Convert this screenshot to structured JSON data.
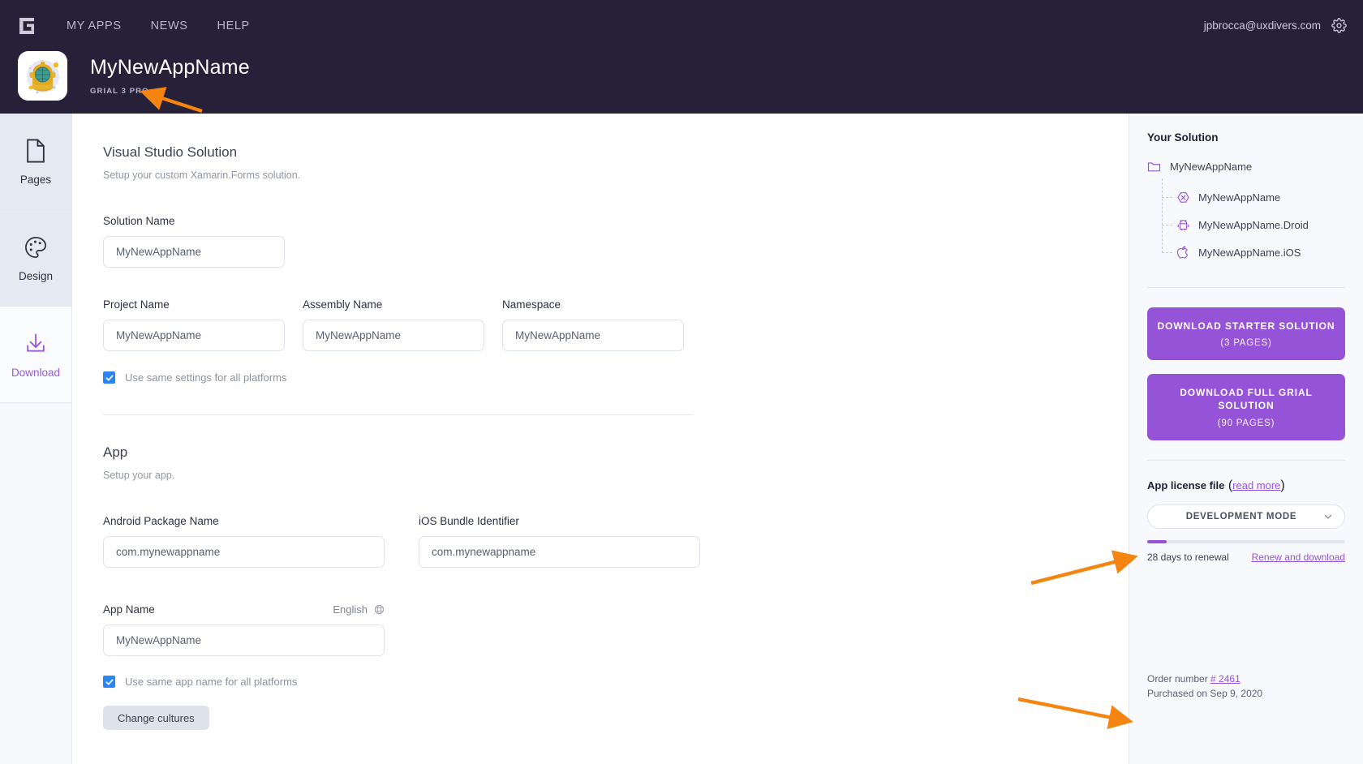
{
  "header": {
    "logo_icon": "grial-logo-icon",
    "nav": [
      {
        "label": "MY APPS"
      },
      {
        "label": "NEWS"
      },
      {
        "label": "HELP"
      }
    ],
    "user_email": "jpbrocca@uxdivers.com",
    "settings_icon": "gear-icon",
    "app_title": "MyNewAppName",
    "app_subtitle": "GRIAL 3 PRO",
    "app_icon": "diving-helmet-icon",
    "background_color": "#262138"
  },
  "sidebar": {
    "items": [
      {
        "label": "Pages",
        "icon": "document-icon",
        "active": false
      },
      {
        "label": "Design",
        "icon": "palette-icon",
        "active": false
      },
      {
        "label": "Download",
        "icon": "download-icon",
        "active": true
      }
    ],
    "active_color": "#9b59e0"
  },
  "main": {
    "solution_section": {
      "title": "Visual Studio Solution",
      "subtitle": "Setup your custom Xamarin.Forms solution.",
      "fields": [
        {
          "label": "Solution Name",
          "value": "MyNewAppName"
        },
        {
          "label": "Project Name",
          "value": "MyNewAppName"
        },
        {
          "label": "Assembly Name",
          "value": "MyNewAppName"
        },
        {
          "label": "Namespace",
          "value": "MyNewAppName"
        }
      ],
      "checkbox": {
        "label": "Use same settings for all platforms",
        "checked": true
      }
    },
    "app_section": {
      "title": "App",
      "subtitle": "Setup your app.",
      "fields": [
        {
          "label": "Android Package Name",
          "value": "com.mynewappname"
        },
        {
          "label": "iOS Bundle Identifier",
          "value": "com.mynewappname"
        }
      ],
      "app_name": {
        "label": "App Name",
        "language": "English",
        "language_icon": "globe-icon",
        "value": "MyNewAppName"
      },
      "checkbox": {
        "label": "Use same app name for all platforms",
        "checked": true
      },
      "cultures_button": "Change cultures"
    },
    "checkbox_color": "#2a86f4"
  },
  "right_panel": {
    "title": "Your Solution",
    "tree": {
      "root": {
        "label": "MyNewAppName",
        "icon": "folder-icon"
      },
      "children": [
        {
          "label": "MyNewAppName",
          "icon": "xamarin-icon"
        },
        {
          "label": "MyNewAppName.Droid",
          "icon": "android-icon"
        },
        {
          "label": "MyNewAppName.iOS",
          "icon": "apple-icon"
        }
      ]
    },
    "download_buttons": [
      {
        "main": "DOWNLOAD STARTER SOLUTION",
        "sub": "(3 PAGES)"
      },
      {
        "main": "DOWNLOAD FULL GRIAL SOLUTION",
        "sub": "(90 PAGES)"
      }
    ],
    "license": {
      "title": "App license file",
      "read_more": "read more",
      "paren_open": "(",
      "paren_close": ")",
      "mode": "DEVELOPMENT MODE",
      "chevron_icon": "chevron-down-icon",
      "progress_percent": 10,
      "days_text": "28 days to renewal",
      "renew_link": "Renew and download"
    },
    "order": {
      "label": "Order number",
      "number": "# 2461",
      "purchased": "Purchased on Sep 9, 2020"
    },
    "accent_color": "#9554d8"
  },
  "annotations": {
    "arrow_color": "#f58410",
    "arrows": [
      {
        "target": "GRIAL 3 PRO"
      },
      {
        "target": "28 days to renewal"
      },
      {
        "target": "Order number"
      }
    ]
  }
}
